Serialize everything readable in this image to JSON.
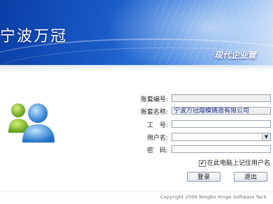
{
  "header": {
    "brand": "宁波万冠",
    "tagline": "现代企业管"
  },
  "form": {
    "account_no_label": "账套编号:",
    "account_no_value": "",
    "account_name_label": "账套名称:",
    "account_name_value": "宁波万冠熔模铸造有限公司",
    "employee_no_label": "工　号:",
    "employee_no_value": "",
    "username_label": "用户名:",
    "username_value": "",
    "password_label": "密　码:",
    "password_value": "",
    "remember_label": "在此电脑上记住用户名",
    "remember_checked": "✔"
  },
  "buttons": {
    "login": "登录",
    "exit": "退出"
  },
  "footer": {
    "copyright": "Copyright 2006 Ningbo Hinge Software Tech"
  },
  "colors": {
    "banner": "#1a5cc8",
    "value_text": "#1a2a88"
  }
}
